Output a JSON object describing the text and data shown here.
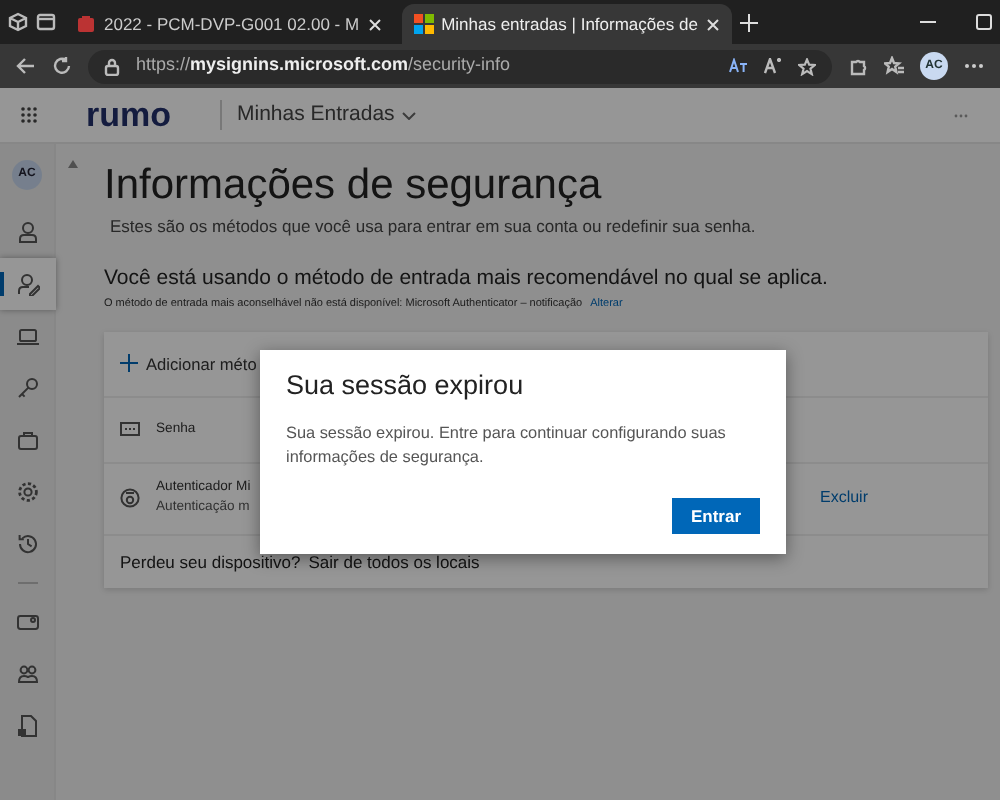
{
  "browser": {
    "tabs": [
      {
        "kind": "pdf",
        "label": "2022 - PCM-DVP-G001 02.00 - M",
        "selected": false
      },
      {
        "kind": "microsoft",
        "label": "Minhas entradas | Informações de",
        "selected": true
      }
    ],
    "address": "https://**mysignins.microsoft.com**/security-info",
    "profile": "AC"
  },
  "app_header": {
    "logo": "rumo",
    "app_name": "Minhas Entradas"
  },
  "sidebar": {
    "avatar": "AC",
    "items": [
      {
        "kind": "person",
        "selected": false
      },
      {
        "kind": "person-edit",
        "selected": true
      },
      {
        "kind": "laptop",
        "selected": false
      },
      {
        "kind": "key",
        "selected": false
      },
      {
        "kind": "briefcase",
        "selected": false
      },
      {
        "kind": "gear",
        "selected": false
      },
      {
        "kind": "history",
        "selected": false
      },
      {
        "kind": "divider"
      },
      {
        "kind": "card",
        "selected": false
      },
      {
        "kind": "people",
        "selected": false
      },
      {
        "kind": "lock-doc",
        "selected": false
      }
    ]
  },
  "page": {
    "title": "Informações de segurança",
    "subtitle": "Estes são os métodos que você usa para entrar em sua conta ou redefinir sua senha.",
    "default_method": "Você está usando o método de entrada mais recomendável no qual se aplica.",
    "note": "O método de entrada mais aconselhável não está disponível: Microsoft Authenticator – notificação",
    "change_link": "Alterar",
    "add_method": "Adicionar méto",
    "methods": [
      {
        "kind": "password",
        "name": "Senha"
      },
      {
        "kind": "authenticator",
        "name": "Autenticador Mi",
        "detail": "Autenticação m",
        "action": "Excluir"
      }
    ],
    "lost_device": "Perdeu seu dispositivo?",
    "lost_link": "Sair de todos os locais"
  },
  "dialog": {
    "title": "Sua sessão expirou",
    "body": "Sua sessão expirou. Entre para continuar configurando suas informações de segurança.",
    "button": "Entrar"
  }
}
